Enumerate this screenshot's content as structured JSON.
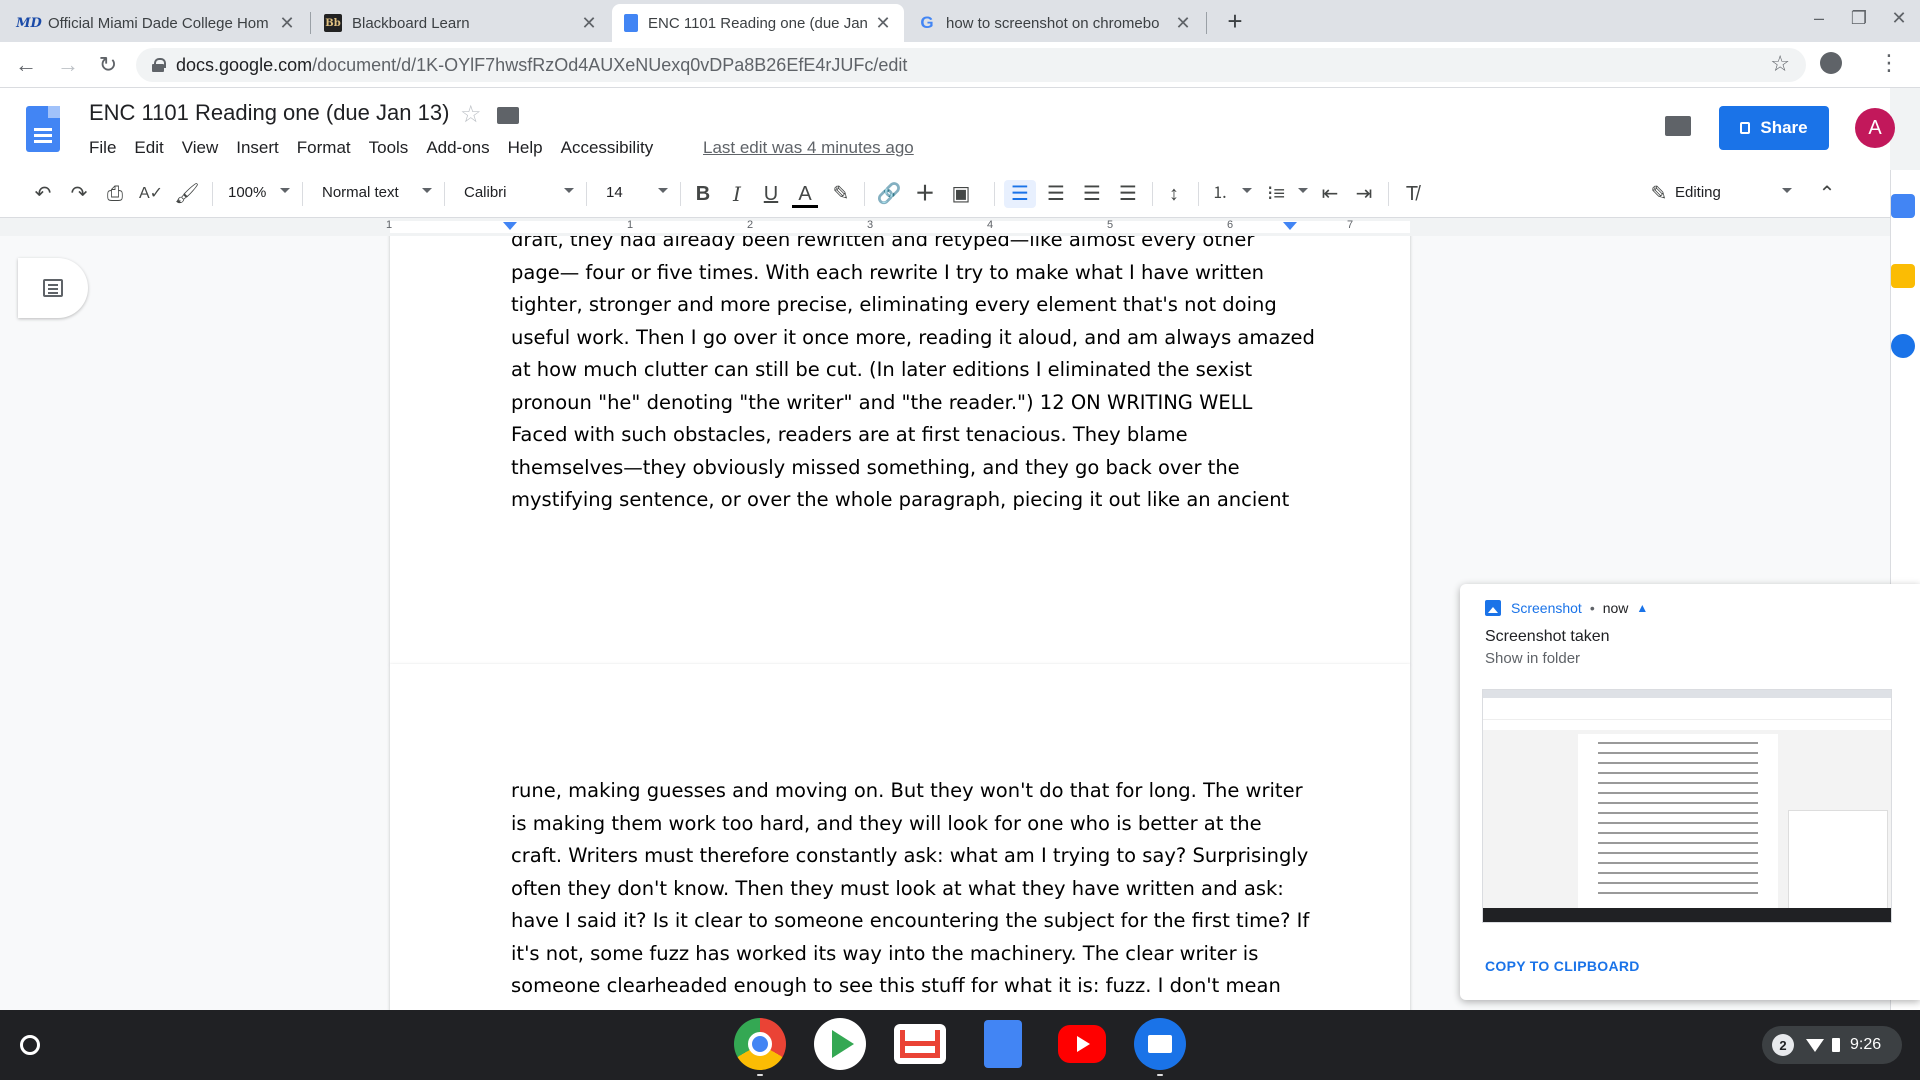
{
  "browser": {
    "tabs": [
      {
        "title": "Official Miami Dade College Hom",
        "favicon": "mdc-logo-icon",
        "active": false
      },
      {
        "title": "Blackboard Learn",
        "favicon": "blackboard-icon",
        "active": false
      },
      {
        "title": "ENC 1101 Reading one (due Jan",
        "favicon": "google-docs-icon",
        "active": true
      },
      {
        "title": "how to screenshot on chromebo",
        "favicon": "google-icon",
        "active": false
      }
    ],
    "url_host": "docs.google.com",
    "url_path": "/document/d/1K-OYlF7hwsfRzOd4AUXeNUexq0vDPa8B26EfE4rJUFc/edit"
  },
  "docs": {
    "title": "ENC 1101 Reading one (due Jan 13)",
    "menu": [
      "File",
      "Edit",
      "View",
      "Insert",
      "Format",
      "Tools",
      "Add-ons",
      "Help",
      "Accessibility"
    ],
    "last_edit": "Last edit was 4 minutes ago",
    "share_label": "Share",
    "avatar_letter": "A",
    "toolbar": {
      "zoom": "100%",
      "style": "Normal text",
      "font": "Calibri",
      "size": "14",
      "mode": "Editing"
    },
    "ruler_labels": [
      "1",
      "1",
      "2",
      "3",
      "4",
      "5",
      "6",
      "7"
    ]
  },
  "page1_lines": [
    "draft, they had already been rewritten and retyped—like almost every other",
    "page— four or five times. With each rewrite I try to make what I have written",
    "tighter, stronger and more precise, eliminating every element that's not doing",
    "useful work. Then I go over it once more, reading it aloud, and am always amazed",
    "at how much clutter can still be cut. (In later editions I eliminated the sexist",
    "pronoun \"he\" denoting \"the writer\" and \"the reader.\") 12 ON WRITING WELL",
    "Faced with such obstacles, readers are at first tenacious. They blame",
    "themselves—they obviously missed something, and they go back over the",
    "mystifying sentence, or over the whole paragraph, piecing it out like an ancient"
  ],
  "page2_lines": [
    "rune, making guesses and moving on. But they won't do that for long. The writer",
    "is making them work too hard, and they will look for one who is better at the",
    "craft. Writers must therefore constantly ask: what am I trying to say? Surprisingly",
    "often they don't know. Then they must look at what they have written and ask:",
    "have I said it? Is it clear to someone encountering the subject for the first time? If",
    "it's not, some fuzz has worked its way into the machinery. The clear writer is",
    "someone clearheaded enough to see this stuff for what it is: fuzz. I don't mean"
  ],
  "notification": {
    "app": "Screenshot",
    "separator": "•",
    "time": "now",
    "title": "Screenshot taken",
    "subtitle": "Show in folder",
    "action": "COPY TO CLIPBOARD"
  },
  "shelf": {
    "apps": [
      "chrome-icon",
      "play-store-icon",
      "gmail-icon",
      "docs-icon",
      "youtube-icon",
      "files-icon"
    ],
    "notification_count": "2",
    "time": "9:26"
  },
  "colors": {
    "accent": "#1a73e8",
    "docs_blue": "#4285f4",
    "avatar": "#c2185b",
    "shelf": "#202124"
  }
}
